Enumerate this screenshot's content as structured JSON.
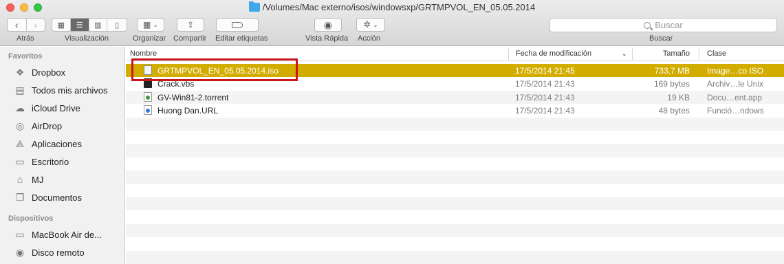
{
  "window": {
    "title": "/Volumes/Mac externo/isos/windowsxp/GRTMPVOL_EN_05.05.2014"
  },
  "toolbar": {
    "back_label": "Atrás",
    "view_label": "Visualización",
    "arrange_label": "Organizar",
    "share_label": "Compartir",
    "tags_label": "Editar etiquetas",
    "quicklook_label": "Vista Rápida",
    "action_label": "Acción",
    "search_placeholder": "Buscar",
    "search_label": "Buscar"
  },
  "sidebar": {
    "favorites_header": "Favoritos",
    "favorites": [
      {
        "label": "Dropbox",
        "icon": "dropbox-icon"
      },
      {
        "label": "Todos mis archivos",
        "icon": "all-files-icon"
      },
      {
        "label": "iCloud Drive",
        "icon": "cloud-icon"
      },
      {
        "label": "AirDrop",
        "icon": "airdrop-icon"
      },
      {
        "label": "Aplicaciones",
        "icon": "applications-icon"
      },
      {
        "label": "Escritorio",
        "icon": "desktop-icon"
      },
      {
        "label": "MJ",
        "icon": "home-icon"
      },
      {
        "label": "Documentos",
        "icon": "documents-icon"
      }
    ],
    "devices_header": "Dispositivos",
    "devices": [
      {
        "label": "MacBook Air de...",
        "icon": "laptop-icon"
      },
      {
        "label": "Disco remoto",
        "icon": "remote-disc-icon"
      }
    ]
  },
  "columns": {
    "name": "Nombre",
    "date": "Fecha de modificación",
    "size": "Tamaño",
    "kind": "Clase"
  },
  "files": [
    {
      "name": "GRTMPVOL_EN_05.05.2014.iso",
      "date": "17/5/2014 21:45",
      "size": "733,7 MB",
      "kind": "Image…co ISO",
      "selected": true
    },
    {
      "name": "Crack.vbs",
      "date": "17/5/2014 21:43",
      "size": "169 bytes",
      "kind": "Archiv…le Unix",
      "selected": false
    },
    {
      "name": "GV-Win81-2.torrent",
      "date": "17/5/2014 21:43",
      "size": "19 KB",
      "kind": "Docu…ent.app",
      "selected": false
    },
    {
      "name": "Huong Dan.URL",
      "date": "17/5/2014 21:43",
      "size": "48 bytes",
      "kind": "Funció…ndows",
      "selected": false
    }
  ],
  "colors": {
    "selection": "#d2ad00",
    "annotation": "#c8161b"
  }
}
